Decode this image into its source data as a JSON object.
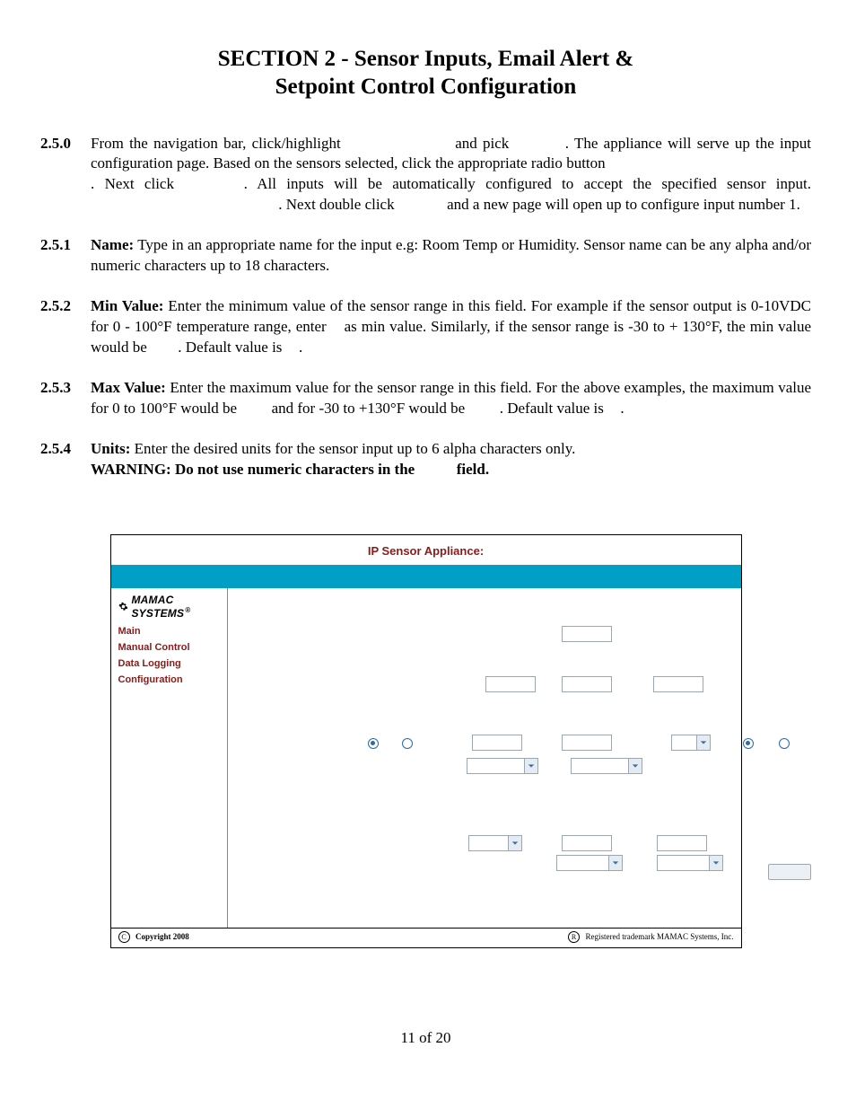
{
  "title_l1": "SECTION 2 - Sensor Inputs, Email Alert &",
  "title_l2": "Setpoint Control Configuration",
  "items": {
    "i0": {
      "num": "2.5.0",
      "t1": "From the navigation bar, click/highlight ",
      "t2": " and pick ",
      "t3": ". The appliance will serve up the input configuration page. Based on the sensors selected, click the appropriate radio button ",
      "t4": ". Next click ",
      "t5": ". All inputs will be automatically configured to accept the specified sensor input. ",
      "t6": ". Next double click ",
      "t7": " and a new page will open up to configure input number 1."
    },
    "i1": {
      "num": "2.5.1",
      "label": "Name:",
      "body": " Type in an appropriate name for the input e.g: Room Temp or Humidity. Sensor name can be any alpha and/or numeric characters up to 18 characters."
    },
    "i2": {
      "num": "2.5.2",
      "label": "Min Value:",
      "t1": " Enter the minimum value of the sensor range in this field. For example if the sensor output is 0-10VDC for 0 - 100°F temperature range, enter ",
      "t2": " as min value. Similarly, if the sensor range is -30 to + 130°F, the min value would be ",
      "t3": ". Default value is ",
      "t4": "."
    },
    "i3": {
      "num": "2.5.3",
      "label": "Max Value:",
      "t1": " Enter the maximum value for the sensor range in this field. For the above examples, the maximum value for 0 to 100°F would be ",
      "t2": " and for -30 to +130°F would be ",
      "t3": ". Default value is ",
      "t4": "."
    },
    "i4": {
      "num": "2.5.4",
      "label": "Units:",
      "body": " Enter the desired units for the sensor input up to 6 alpha characters only.",
      "warn1": "WARNING: Do not use numeric characters in the ",
      "warn2": " field."
    }
  },
  "shot": {
    "header": "IP Sensor Appliance:",
    "brand": "MAMAC SYSTEMS",
    "brand_sup": "®",
    "nav": {
      "main": "Main",
      "manual": "Manual Control",
      "datalog": "Data Logging",
      "config": "Configuration"
    },
    "footer_left_symbol": "C",
    "footer_left": "Copyright 2008",
    "footer_right_symbol": "R",
    "footer_right": "Registered trademark MAMAC Systems, Inc."
  },
  "page_number": "11 of 20"
}
